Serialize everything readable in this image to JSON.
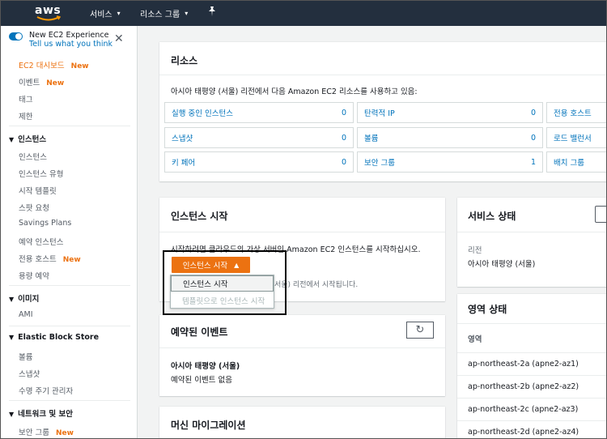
{
  "topnav": {
    "logo": "aws",
    "services": "서비스",
    "resource_groups": "리소스 그룹",
    "pin_icon": "pin-icon"
  },
  "sidebar": {
    "toggle_title": "New EC2 Experience",
    "toggle_link": "Tell us what you think",
    "items": [
      {
        "label": "EC2 대시보드",
        "new": "New",
        "active": true
      },
      {
        "label": "이벤트",
        "new": "New"
      },
      {
        "label": "태그"
      },
      {
        "label": "제한"
      }
    ],
    "sections": [
      {
        "title": "인스턴스",
        "items": [
          {
            "label": "인스턴스"
          },
          {
            "label": "인스턴스 유형"
          },
          {
            "label": "시작 템플릿"
          },
          {
            "label": "스팟 요청"
          },
          {
            "label": "Savings Plans"
          },
          {
            "label": "예약 인스턴스"
          },
          {
            "label": "전용 호스트",
            "new": "New"
          },
          {
            "label": "용량 예약"
          }
        ]
      },
      {
        "title": "이미지",
        "items": [
          {
            "label": "AMI"
          }
        ]
      },
      {
        "title": "Elastic Block Store",
        "items": [
          {
            "label": "볼륨"
          },
          {
            "label": "스냅샷"
          },
          {
            "label": "수명 주기 관리자"
          }
        ]
      },
      {
        "title": "네트워크 및 보안",
        "items": [
          {
            "label": "보안 그룹",
            "new": "New"
          }
        ]
      }
    ]
  },
  "resources": {
    "title": "리소스",
    "desc": "아시아 태평양 (서울) 리전에서 다음 Amazon EC2 리소스를 사용하고 있음:",
    "cells": [
      {
        "label": "실행 중인 인스턴스",
        "count": "0"
      },
      {
        "label": "탄력적 IP",
        "count": "0"
      },
      {
        "label": "전용 호스트",
        "count": ""
      },
      {
        "label": "스냅샷",
        "count": "0"
      },
      {
        "label": "볼륨",
        "count": "0"
      },
      {
        "label": "로드 밸런서",
        "count": ""
      },
      {
        "label": "키 페어",
        "count": "0"
      },
      {
        "label": "보안 그룹",
        "count": "1"
      },
      {
        "label": "배치 그룹",
        "count": ""
      }
    ]
  },
  "launch": {
    "title": "인스턴스 시작",
    "desc": "시작하려면 클라우드의 가상 서버인 Amazon EC2 인스턴스를 시작하십시오.",
    "note_tail": "서울) 리전에서 시작됩니다.",
    "button": "인스턴스 시작",
    "menu": [
      "인스턴스 시작",
      "템플릿으로 인스턴스 시작"
    ]
  },
  "events": {
    "title": "예약된 이벤트",
    "region": "아시아 태평양 (서울)",
    "none": "예약된 이벤트 없음"
  },
  "migration": {
    "title": "머신 마이그레이션"
  },
  "service_health": {
    "title": "서비스 상태",
    "region_label": "리전",
    "region_value": "아시아 태평양 (서울)"
  },
  "zone_status": {
    "title": "영역 상태",
    "column": "영역",
    "zones": [
      "ap-northeast-2a (apne2-az1)",
      "ap-northeast-2b (apne2-az2)",
      "ap-northeast-2c (apne2-az3)",
      "ap-northeast-2d (apne2-az4)"
    ]
  },
  "colors": {
    "accent": "#ec7211",
    "link": "#0073bb",
    "nav_bg": "#232f3e"
  }
}
